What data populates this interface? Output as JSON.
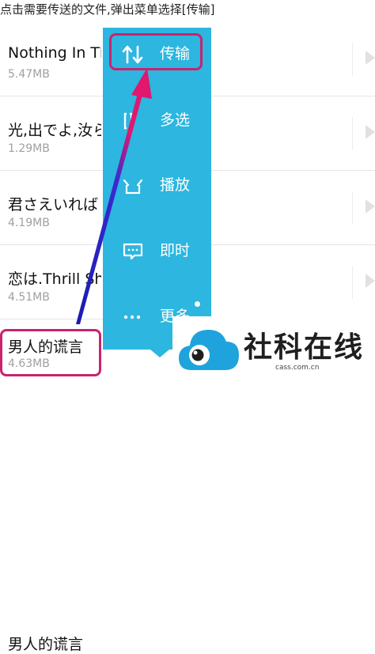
{
  "caption": "点击需要传送的文件,弹出菜单选择[传输]",
  "songs": [
    {
      "title": "Nothing In The",
      "size": "5.47MB"
    },
    {
      "title": "光,出でよ,汝ら",
      "size": "1.29MB"
    },
    {
      "title": "君さえいれば",
      "size": "4.19MB"
    },
    {
      "title": "恋は.Thrill Sh",
      "size": "4.51MB"
    },
    {
      "title": "男人的谎言",
      "size": "4.63MB"
    }
  ],
  "menu": {
    "items": [
      {
        "label": "传输",
        "icon": "transfer-arrows-icon"
      },
      {
        "label": "多选",
        "icon": "multi-select-icon"
      },
      {
        "label": "播放",
        "icon": "play-tray-icon"
      },
      {
        "label": "即时",
        "icon": "chat-bubble-icon"
      },
      {
        "label": "更多",
        "icon": "more-dots-icon"
      }
    ]
  },
  "colors": {
    "menu_bg": "#2cb6e0",
    "highlight": "#c8246e",
    "arrow": "#2a2ab8"
  },
  "watermark": {
    "name": "社科在线",
    "site": "cass.com.cn"
  }
}
